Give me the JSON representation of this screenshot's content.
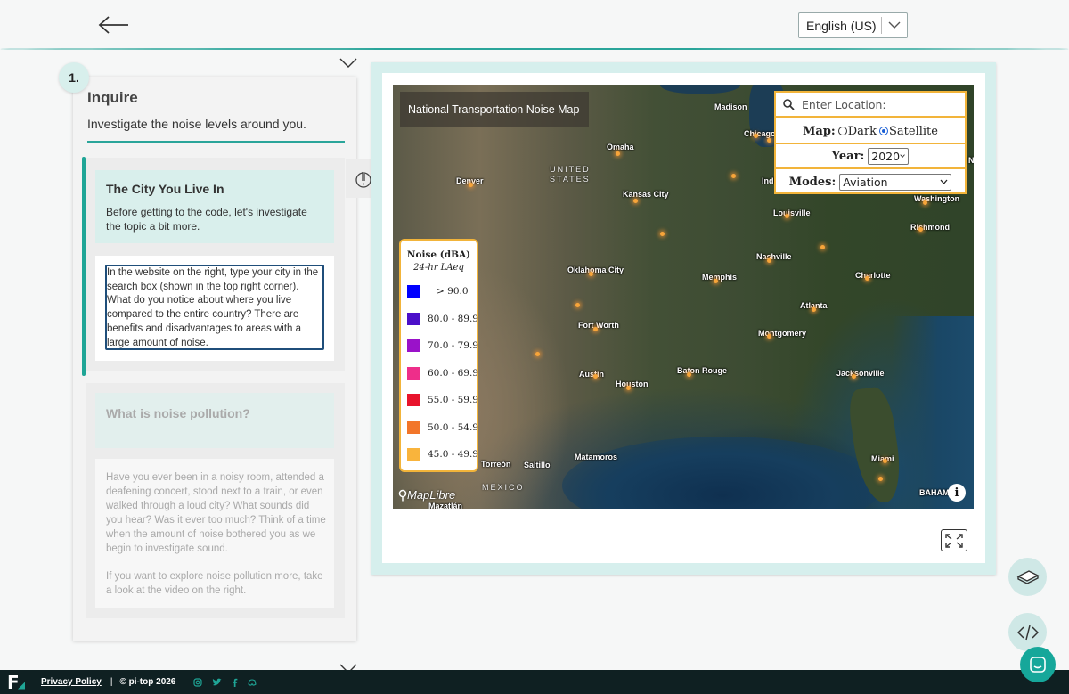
{
  "header": {
    "language": "English (US)"
  },
  "lesson": {
    "step_number": "1.",
    "title": "Inquire",
    "subtitle": "Investigate the noise levels around you.",
    "active_card": {
      "title": "The City You Live In",
      "description": "Before getting to the code, let's investigate the topic a bit more.",
      "instruction": "In the website on the right, type your city in the search box (shown in the top right corner). What do you notice about where you live compared to the entire country? There are benefits and disadvantages to areas with a large amount of noise."
    },
    "next_card": {
      "title": "What is noise pollution?",
      "paragraph1": "Have you ever been in a noisy room, attended a deafening concert, stood next to a train, or even walked through a loud city? What sounds did you hear? Was it ever too much? Think of a time when the amount of noise bothered you as we begin to investigate sound.",
      "paragraph2": "If you want to explore noise pollution more, take a look at the video on the right."
    }
  },
  "map": {
    "title": "National Transportation Noise Map",
    "search_placeholder": "Enter Location:",
    "map_label": "Map:",
    "map_options": [
      "Dark",
      "Satellite"
    ],
    "map_selected": "Satellite",
    "year_label": "Year:",
    "year_value": "2020",
    "modes_label": "Modes:",
    "modes_value": "Aviation",
    "attribution": "MapLibre",
    "info_glyph": "i",
    "cities": [
      {
        "name": "Madison"
      },
      {
        "name": "Chicago"
      },
      {
        "name": "Omaha"
      },
      {
        "name": "Denver"
      },
      {
        "name": "Kansas City"
      },
      {
        "name": "Indi"
      },
      {
        "name": "Louisville"
      },
      {
        "name": "Washington"
      },
      {
        "name": "Richmond"
      },
      {
        "name": "Nashville"
      },
      {
        "name": "Oklahoma City"
      },
      {
        "name": "Memphis"
      },
      {
        "name": "Charlotte"
      },
      {
        "name": "Atlanta"
      },
      {
        "name": "Fort Worth"
      },
      {
        "name": "Montgomery"
      },
      {
        "name": "Austin"
      },
      {
        "name": "Baton Rouge"
      },
      {
        "name": "Jacksonville"
      },
      {
        "name": "Houston"
      },
      {
        "name": "Torreón"
      },
      {
        "name": "Saltillo"
      },
      {
        "name": "Matamoros"
      },
      {
        "name": "Miami"
      },
      {
        "name": "Mazatlán"
      },
      {
        "name": "BAHAM"
      },
      {
        "name": "N"
      }
    ],
    "countries": [
      "UNITED STATES",
      "MEXICO"
    ],
    "legend": {
      "title": "Noise (dBA)",
      "subtitle": "24-hr LAeq",
      "items": [
        {
          "label": "> 90.0",
          "color": "#0000ff"
        },
        {
          "label": "80.0 - 89.9",
          "color": "#4b0fc9"
        },
        {
          "label": "70.0 - 79.9",
          "color": "#9a12c9"
        },
        {
          "label": "60.0 - 69.9",
          "color": "#ee2e8a"
        },
        {
          "label": "55.0 - 59.9",
          "color": "#e8142c"
        },
        {
          "label": "50.0 - 54.9",
          "color": "#f2762a"
        },
        {
          "label": "45.0 - 49.9",
          "color": "#f9b43c"
        }
      ]
    }
  },
  "footer": {
    "privacy": "Privacy Policy",
    "separator": "|",
    "copyright": "© pi-top 2026",
    "logo": "F"
  },
  "colors": {
    "accent": "#1fa596",
    "legend_border": "#f2b43a",
    "footer_bg": "#0f2022"
  }
}
